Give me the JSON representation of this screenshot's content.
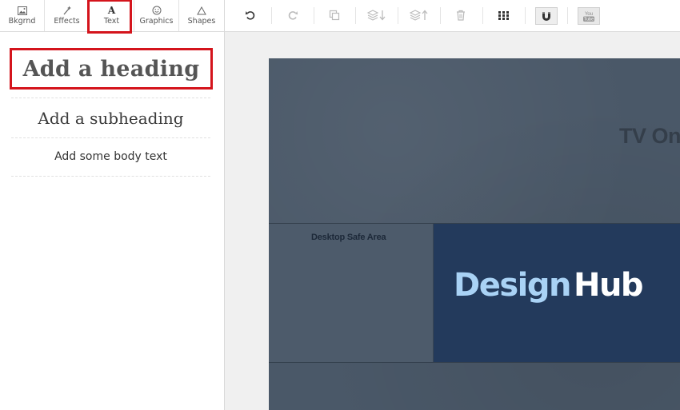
{
  "tabs": [
    {
      "label": "Bkgrnd",
      "icon": "image-icon"
    },
    {
      "label": "Effects",
      "icon": "magic-wand-icon"
    },
    {
      "label": "Text",
      "icon": "text-icon",
      "glyph": "A"
    },
    {
      "label": "Graphics",
      "icon": "smiley-icon"
    },
    {
      "label": "Shapes",
      "icon": "triangle-icon"
    }
  ],
  "active_tab": "Text",
  "text_panel": {
    "heading": "Add a heading",
    "subheading": "Add a subheading",
    "body": "Add some body text"
  },
  "toolbar": {
    "icons": [
      "undo-icon",
      "redo-icon",
      "duplicate-icon",
      "send-backward-icon",
      "bring-forward-icon",
      "delete-icon",
      "grid-icon",
      "magnet-icon",
      "youtube-icon"
    ],
    "youtube_label": "You Tube"
  },
  "canvas": {
    "tv_text": "TV On",
    "safe_area_label": "Desktop Safe Area",
    "logo_part1": "Design",
    "logo_part2": "Hub"
  },
  "colors": {
    "highlight": "#d4141c",
    "canvas_bg": "#4a5868",
    "logo_bg": "#233a5c",
    "logo_light": "#a9d2f5"
  }
}
